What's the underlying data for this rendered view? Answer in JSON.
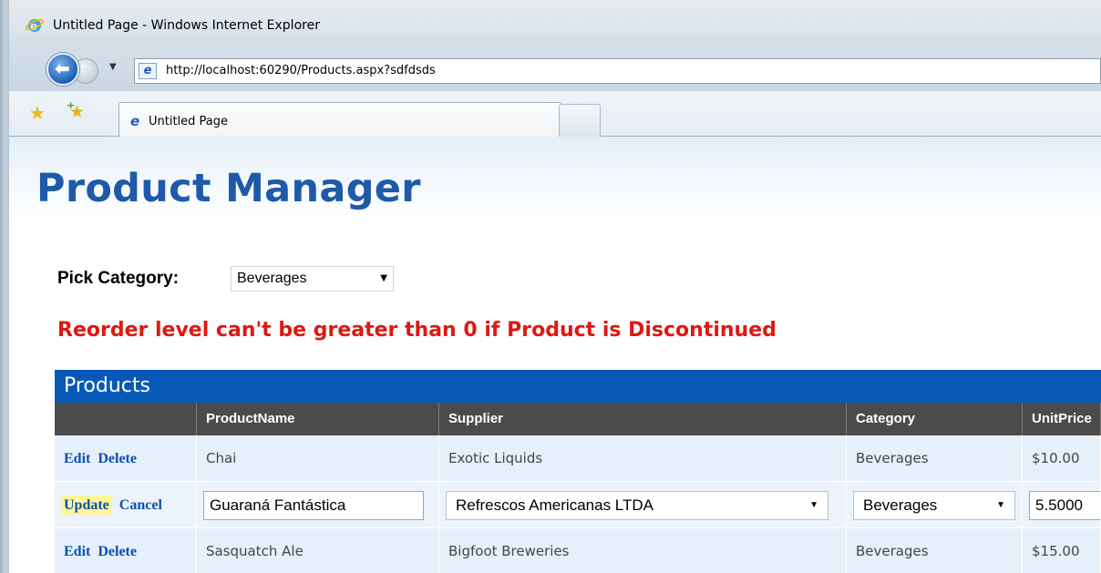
{
  "window": {
    "title": "Untitled Page - Windows Internet Explorer"
  },
  "nav": {
    "url": "http://localhost:60290/Products.aspx?sdfdsds"
  },
  "tabs": [
    {
      "label": "Untitled Page"
    }
  ],
  "page": {
    "title": "Product Manager",
    "pick_category_label": "Pick Category:",
    "category_selected": "Beverages",
    "error_message": "Reorder level can't be greater than 0 if Product is Discontinued"
  },
  "grid": {
    "caption": "Products",
    "columns": [
      "",
      "ProductName",
      "Supplier",
      "Category",
      "UnitPrice"
    ],
    "rows": [
      {
        "cmd1": "Edit",
        "cmd2": "Delete",
        "product": "Chai",
        "supplier": "Exotic Liquids",
        "category": "Beverages",
        "price": "$10.00"
      },
      {
        "cmd1": "Update",
        "cmd2": "Cancel",
        "product": "Guaraná Fantástica",
        "supplier": "Refrescos Americanas LTDA",
        "category": "Beverages",
        "price": "5.5000"
      },
      {
        "cmd1": "Edit",
        "cmd2": "Delete",
        "product": "Sasquatch Ale",
        "supplier": "Bigfoot Breweries",
        "category": "Beverages",
        "price": "$15.00"
      }
    ]
  },
  "icons": {
    "ie": "ie-logo-icon",
    "back": "back-arrow-icon",
    "forward": "forward-arrow-icon",
    "favorites": "favorites-star-icon",
    "add_favorites": "add-favorites-icon",
    "dropdown": "chevron-down-icon"
  },
  "colors": {
    "title_blue": "#1e5aa8",
    "error_red": "#e01812",
    "grid_caption": "#0859b7",
    "grid_header": "#4b4b4b",
    "row_bg": "#e5f0fa",
    "update_highlight": "#fff69a"
  }
}
